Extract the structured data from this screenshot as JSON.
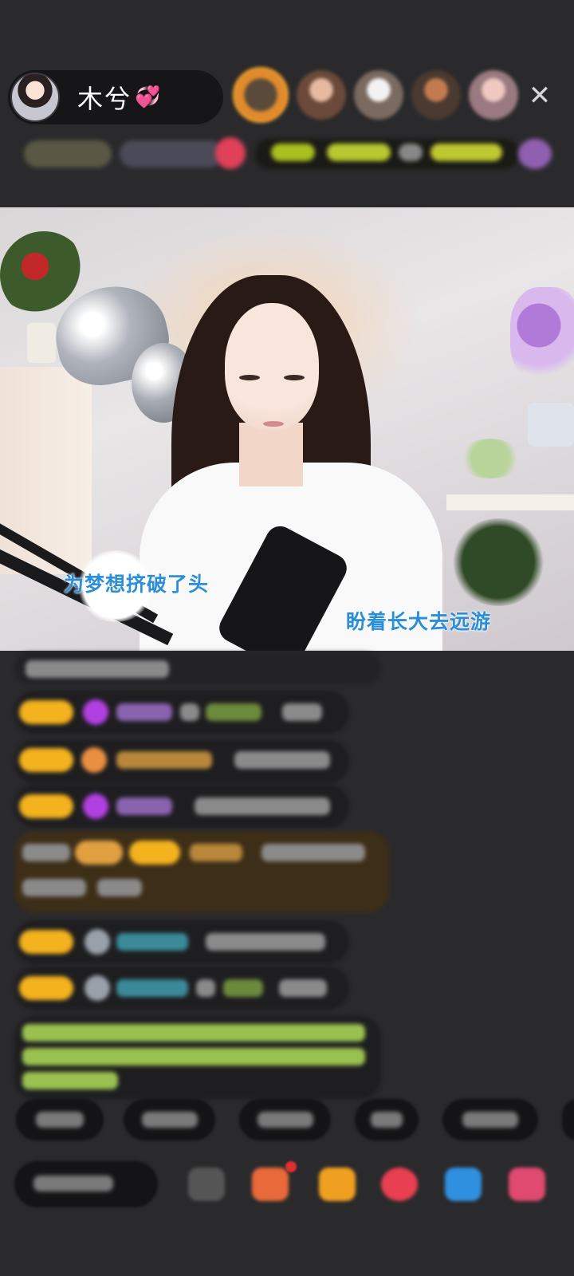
{
  "header": {
    "host_name": "木兮",
    "host_badge_icon": "pink-double-heart-icon",
    "close_icon": "close-icon"
  },
  "video": {
    "lyric_left": "为梦想挤破了头",
    "lyric_right": "盼着长大去远游",
    "lyric_color": "#2a8fd8"
  },
  "colors": {
    "background": "#2a2a2c",
    "level_badge": "#f3b21e"
  }
}
